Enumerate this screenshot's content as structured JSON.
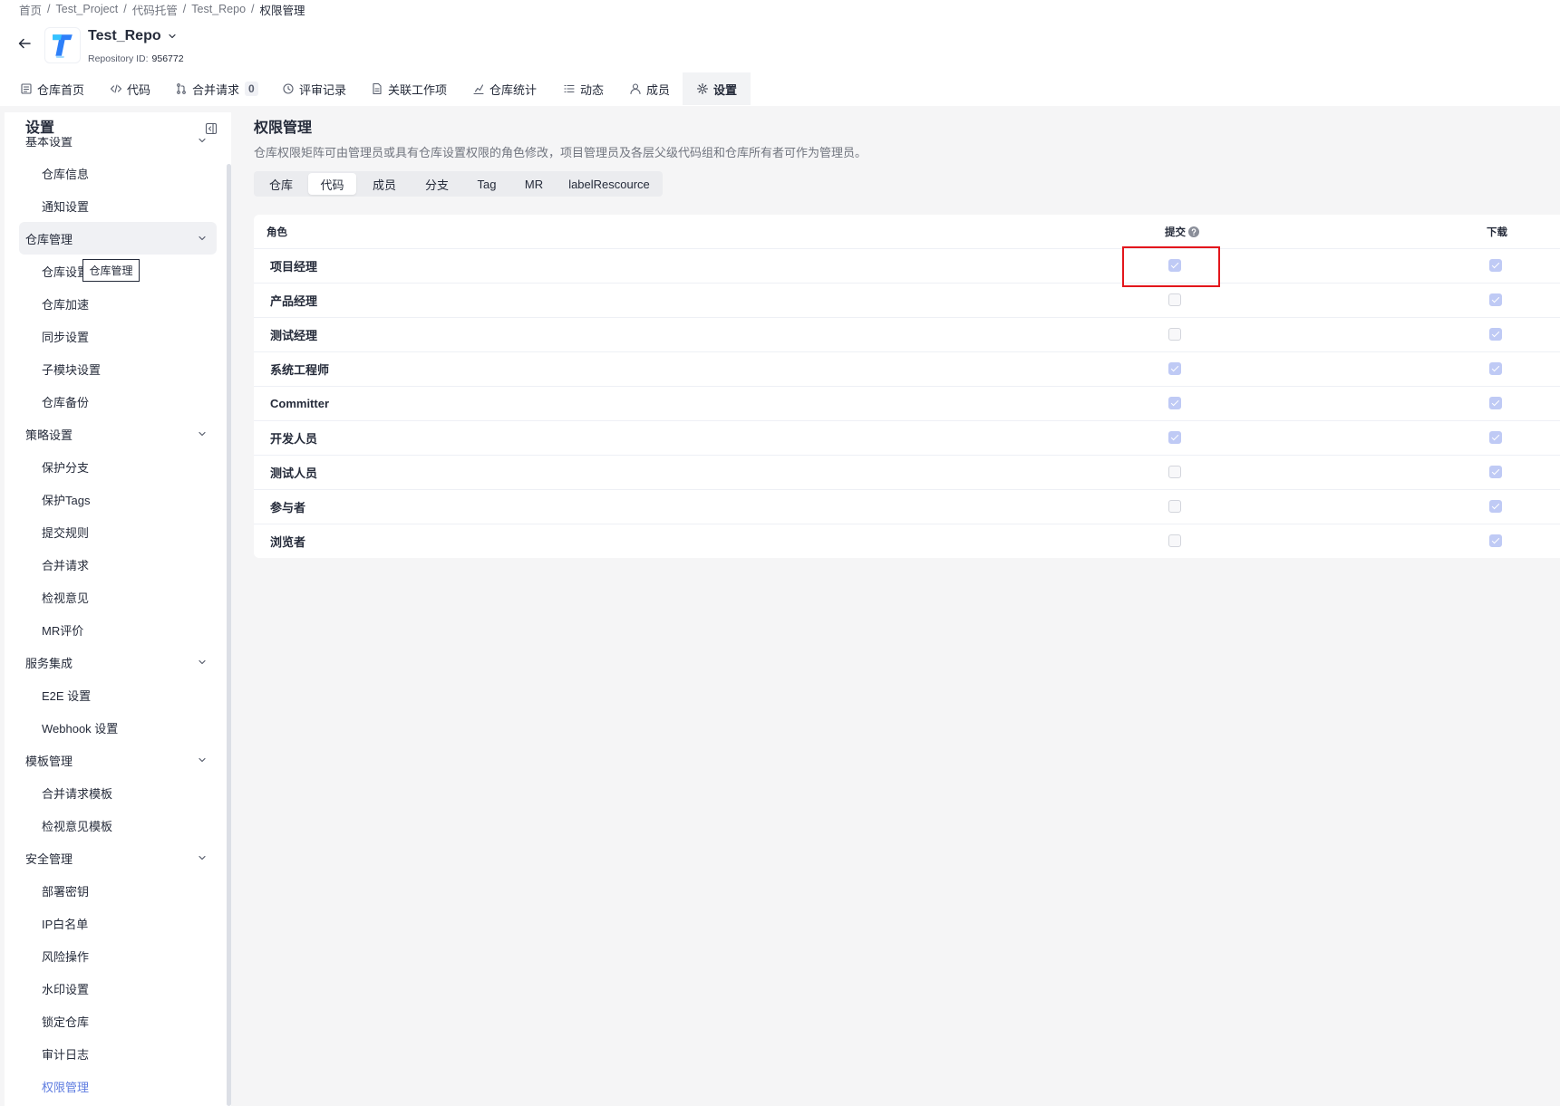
{
  "breadcrumb": {
    "items": [
      "首页",
      "Test_Project",
      "代码托管",
      "Test_Repo",
      "权限管理"
    ],
    "separator": "/"
  },
  "repo": {
    "name": "Test_Repo",
    "id_label": "Repository ID:",
    "id_value": "956772",
    "logo_icon": "repo-logo"
  },
  "nav_tabs": [
    {
      "label": "仓库首页",
      "icon": "repo-home-icon"
    },
    {
      "label": "代码",
      "icon": "code-icon"
    },
    {
      "label": "合并请求",
      "icon": "merge-request-icon",
      "badge": "0"
    },
    {
      "label": "评审记录",
      "icon": "review-icon"
    },
    {
      "label": "关联工作项",
      "icon": "work-item-icon"
    },
    {
      "label": "仓库统计",
      "icon": "stats-icon"
    },
    {
      "label": "动态",
      "icon": "activity-icon"
    },
    {
      "label": "成员",
      "icon": "member-icon"
    },
    {
      "label": "设置",
      "icon": "gear-icon",
      "active": true
    }
  ],
  "sidebar": {
    "title": "设置",
    "tooltip": "仓库管理",
    "groups": [
      {
        "label": "基本设置",
        "items": [
          {
            "label": "仓库信息"
          },
          {
            "label": "通知设置"
          }
        ]
      },
      {
        "label": "仓库管理",
        "highlighted": true,
        "items": [
          {
            "label": "仓库设置"
          },
          {
            "label": "仓库加速"
          },
          {
            "label": "同步设置"
          },
          {
            "label": "子模块设置"
          },
          {
            "label": "仓库备份"
          }
        ]
      },
      {
        "label": "策略设置",
        "items": [
          {
            "label": "保护分支"
          },
          {
            "label": "保护Tags"
          },
          {
            "label": "提交规则"
          },
          {
            "label": "合并请求"
          },
          {
            "label": "检视意见"
          },
          {
            "label": "MR评价"
          }
        ]
      },
      {
        "label": "服务集成",
        "items": [
          {
            "label": "E2E 设置"
          },
          {
            "label": "Webhook 设置"
          }
        ]
      },
      {
        "label": "模板管理",
        "items": [
          {
            "label": "合并请求模板"
          },
          {
            "label": "检视意见模板"
          }
        ]
      },
      {
        "label": "安全管理",
        "items": [
          {
            "label": "部署密钥"
          },
          {
            "label": "IP白名单"
          },
          {
            "label": "风险操作"
          },
          {
            "label": "水印设置"
          },
          {
            "label": "锁定仓库"
          },
          {
            "label": "审计日志"
          },
          {
            "label": "权限管理",
            "active": true
          }
        ]
      }
    ]
  },
  "main": {
    "title": "权限管理",
    "description": "仓库权限矩阵可由管理员或具有仓库设置权限的角色修改，项目管理员及各层父级代码组和仓库所有者可作为管理员。",
    "resource_tabs": [
      {
        "label": "仓库"
      },
      {
        "label": "代码",
        "active": true
      },
      {
        "label": "成员"
      },
      {
        "label": "分支"
      },
      {
        "label": "Tag"
      },
      {
        "label": "MR"
      },
      {
        "label": "labelRescource"
      }
    ],
    "table": {
      "headers": {
        "role": "角色",
        "commit": "提交",
        "download": "下载"
      },
      "checkboxes_disabled": true,
      "rows": [
        {
          "role": "项目经理",
          "commit": true,
          "download": true
        },
        {
          "role": "产品经理",
          "commit": false,
          "download": true
        },
        {
          "role": "测试经理",
          "commit": false,
          "download": true
        },
        {
          "role": "系统工程师",
          "commit": true,
          "download": true
        },
        {
          "role": "Committer",
          "commit": true,
          "download": true
        },
        {
          "role": "开发人员",
          "commit": true,
          "download": true
        },
        {
          "role": "测试人员",
          "commit": false,
          "download": true
        },
        {
          "role": "参与者",
          "commit": false,
          "download": true
        },
        {
          "role": "浏览者",
          "commit": false,
          "download": true
        }
      ]
    }
  },
  "colors": {
    "accent": "#5e7ce0",
    "checked_disabled": "#bfcaf5",
    "highlight_box": "#e3161c",
    "page_background": "#f5f5f6"
  }
}
